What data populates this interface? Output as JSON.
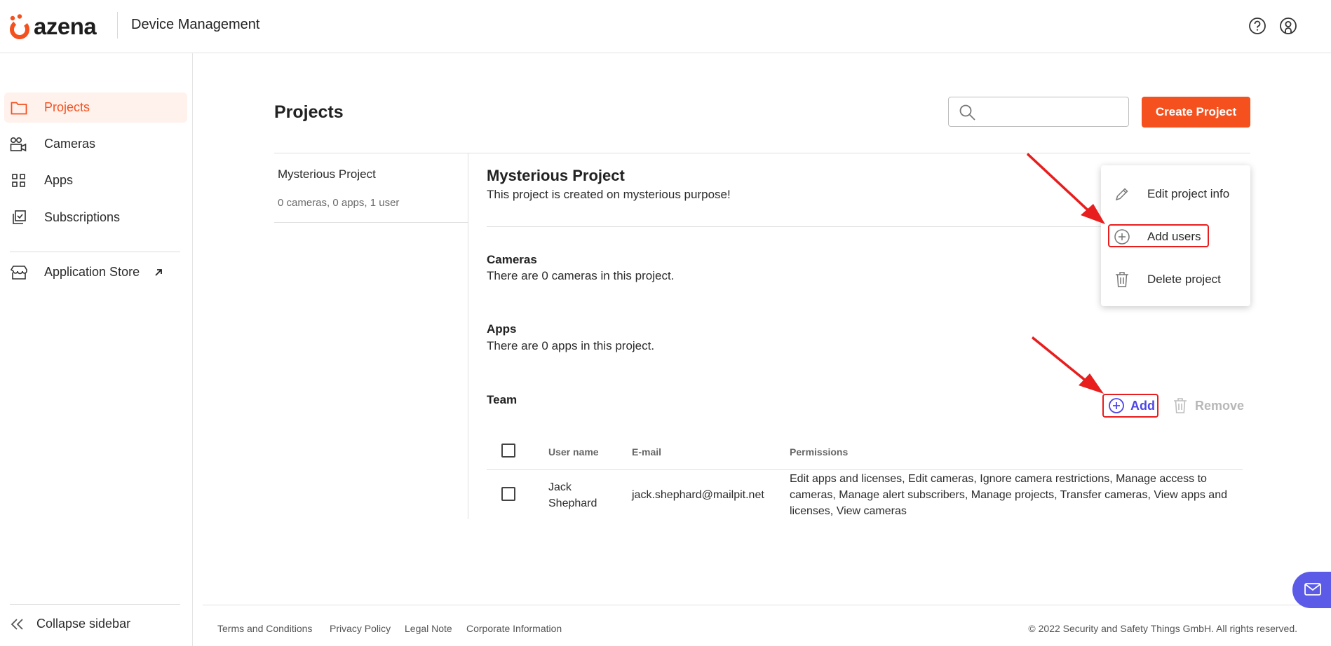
{
  "header": {
    "brand": "azena",
    "app_title": "Device Management"
  },
  "sidebar": {
    "items": [
      {
        "label": "Projects",
        "icon": "folder-icon",
        "active": true
      },
      {
        "label": "Cameras",
        "icon": "camera-icon"
      },
      {
        "label": "Apps",
        "icon": "apps-grid-icon"
      },
      {
        "label": "Subscriptions",
        "icon": "subscriptions-icon"
      }
    ],
    "store": {
      "label": "Application Store",
      "icon": "store-icon",
      "external_icon": "external-link-icon"
    },
    "collapse_label": "Collapse sidebar"
  },
  "main": {
    "title": "Projects",
    "search": {
      "placeholder": "",
      "value": ""
    },
    "create_button": "Create Project",
    "projects": [
      {
        "name": "Mysterious Project",
        "meta": "0 cameras, 0 apps, 1 user"
      }
    ]
  },
  "detail": {
    "title": "Mysterious Project",
    "description": "This project is created on mysterious purpose!",
    "cameras": {
      "title": "Cameras",
      "text": "There are 0 cameras in this project."
    },
    "apps": {
      "title": "Apps",
      "text": "There are 0 apps in this project."
    },
    "team": {
      "title": "Team",
      "add_label": "Add",
      "remove_label": "Remove",
      "columns": [
        "User name",
        "E-mail",
        "Permissions"
      ],
      "rows": [
        {
          "name_line1": "Jack",
          "name_line2": "Shephard",
          "email": "jack.shephard@mailpit.net",
          "perm_line1": "Edit apps and licenses, Edit cameras, Ignore camera restrictions, Manage access to",
          "perm_line2": "cameras, Manage alert subscribers, Manage projects, Transfer cameras, View apps and",
          "perm_line3": "licenses, View cameras"
        }
      ]
    }
  },
  "menu": {
    "items": [
      {
        "label": "Edit project info",
        "icon": "pencil-icon"
      },
      {
        "label": "Add users",
        "icon": "plus-circle-icon"
      },
      {
        "label": "Delete project",
        "icon": "trash-icon"
      }
    ]
  },
  "footer": {
    "links": [
      "Terms and Conditions",
      "Privacy Policy",
      "Legal Note",
      "Corporate Information"
    ],
    "copyright": "© 2022 Security and Safety Things GmbH. All rights reserved."
  },
  "colors": {
    "accent": "#f4511e",
    "active_bg": "#fff1ec",
    "link_blue": "#4f46e5",
    "annotation_red": "#e81d1d",
    "chat_purple": "#5b5be8"
  }
}
